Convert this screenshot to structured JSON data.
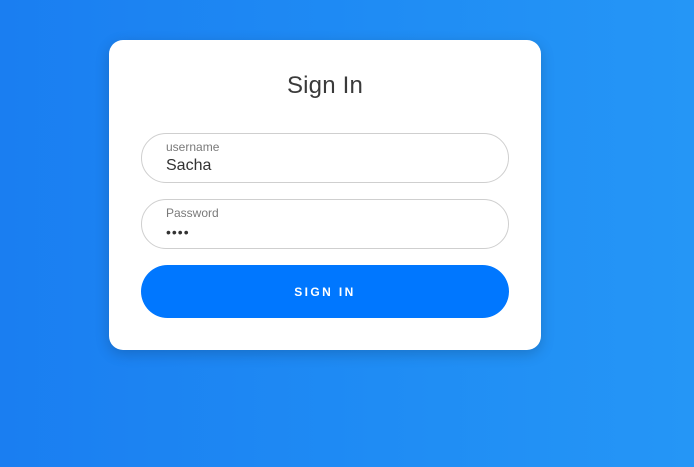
{
  "colors": {
    "background_start": "#1a7ef1",
    "background_end": "#2596f6",
    "card": "#ffffff",
    "button": "#0077ff",
    "button_text": "#ffffff",
    "field_border": "#cfcfcf"
  },
  "login": {
    "title": "Sign In",
    "username": {
      "label": "username",
      "value": "Sacha"
    },
    "password": {
      "label": "Password",
      "value": "••••"
    },
    "submit_label": "SIGN IN"
  }
}
